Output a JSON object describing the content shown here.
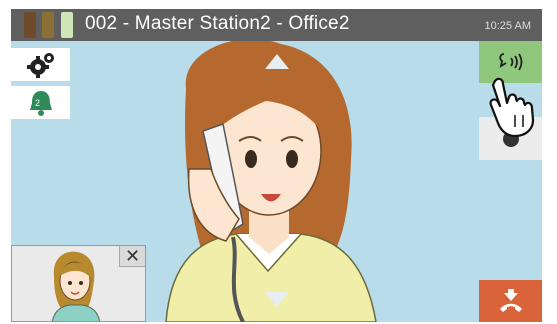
{
  "header": {
    "title": "002 - Master Station2 - Office2",
    "time": "10:25 AM",
    "signal_colors": [
      "#6e4a2a",
      "#8a7034",
      "#cfe6b8"
    ]
  },
  "left_panel": {
    "settings_icon": "gear-icon",
    "bell_badge": "2",
    "bell_color": "#2e8b57"
  },
  "right_panel": {
    "talk_icon": "talk-speech-icon",
    "talk_color": "#8fc77d",
    "record_icon": "record-circle-icon",
    "end_call_icon": "hang-up-icon",
    "end_call_color": "#d9643a"
  },
  "pip": {
    "close_label": "✕"
  },
  "colors": {
    "screen_bg": "#b8dce9",
    "topbar": "#5f5f5f"
  }
}
